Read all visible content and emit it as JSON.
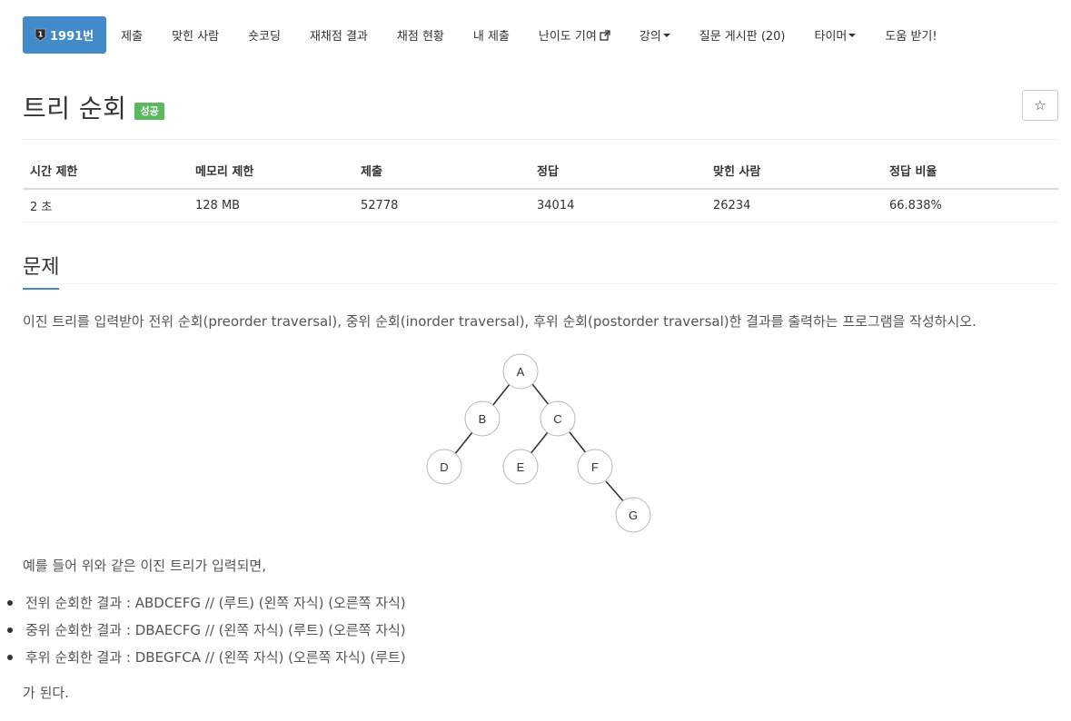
{
  "nav": {
    "problem_number": "1991번",
    "tabs": [
      "제출",
      "맞힌 사람",
      "숏코딩",
      "재채점 결과",
      "채점 현황",
      "내 제출",
      "난이도 기여",
      "강의",
      "질문 게시판 (20)",
      "타이머",
      "도움 받기!"
    ]
  },
  "problem": {
    "title": "트리 순회",
    "badge": "성공",
    "star_icon": "☆"
  },
  "stats": {
    "headers": [
      "시간 제한",
      "메모리 제한",
      "제출",
      "정답",
      "맞힌 사람",
      "정답 비율"
    ],
    "values": [
      "2 초",
      "128 MB",
      "52778",
      "34014",
      "26234",
      "66.838%"
    ]
  },
  "section_title": "문제",
  "description": "이진 트리를 입력받아 전위 순회(preorder traversal), 중위 순회(inorder traversal), 후위 순회(postorder traversal)한 결과를 출력하는 프로그램을 작성하시오.",
  "tree": {
    "nodes": [
      "A",
      "B",
      "C",
      "D",
      "E",
      "F",
      "G"
    ]
  },
  "intro": "예를 들어 위와 같은 이진 트리가 입력되면,",
  "results": [
    "전위 순회한 결과 : ABDCEFG // (루트) (왼쪽 자식) (오른쪽 자식)",
    "중위 순회한 결과 : DBAECFG // (왼쪽 자식) (루트) (오른쪽 자식)",
    "후위 순회한 결과 : DBEGFCA // (왼쪽 자식) (오른쪽 자식) (루트)"
  ],
  "outro": "가 된다."
}
